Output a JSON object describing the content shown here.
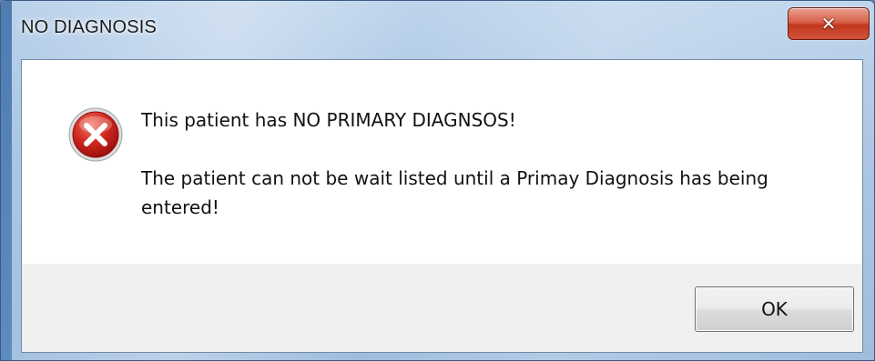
{
  "window": {
    "title": "NO DIAGNOSIS",
    "close_glyph": "✕",
    "close_icon": "close-icon"
  },
  "message": {
    "icon": "error-icon",
    "line1": "This patient has NO PRIMARY DIAGNSOS!",
    "line2": "The patient can not be wait listed until a Primay Diagnosis has being entered!"
  },
  "buttons": {
    "ok_label": "OK"
  },
  "colors": {
    "close_button": "#c2361e",
    "error_icon": "#c51f1f",
    "content_bg": "#ffffff",
    "footer_bg": "#f0f0f0"
  }
}
